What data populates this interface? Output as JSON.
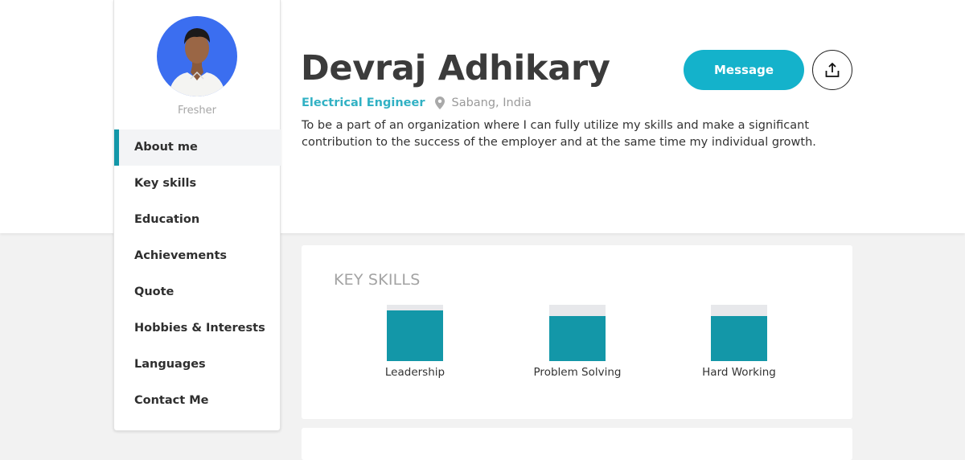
{
  "profile": {
    "name": "Devraj Adhikary",
    "level": "Fresher",
    "title": "Electrical Engineer",
    "location": "Sabang, India",
    "summary": "To be a part of an organization where I can fully utilize my skills and make a significant contribution to the success of the employer and at the same time my individual growth."
  },
  "actions": {
    "message_label": "Message",
    "share_icon": "share-upload-icon"
  },
  "nav": {
    "items": [
      {
        "label": "About me",
        "active": true
      },
      {
        "label": "Key skills"
      },
      {
        "label": "Education"
      },
      {
        "label": "Achievements"
      },
      {
        "label": "Quote"
      },
      {
        "label": "Hobbies & Interests"
      },
      {
        "label": "Languages"
      },
      {
        "label": "Contact Me"
      }
    ]
  },
  "skills": {
    "heading": "KEY SKILLS",
    "items": [
      {
        "label": "Leadership",
        "level": 0.9
      },
      {
        "label": "Problem Solving",
        "level": 0.8
      },
      {
        "label": "Hard Working",
        "level": 0.8
      }
    ]
  },
  "colors": {
    "accent": "#14b2cb",
    "skill_fill": "#1397a8",
    "title_text": "#31b1c4",
    "page_bg": "#f2f2f2"
  }
}
